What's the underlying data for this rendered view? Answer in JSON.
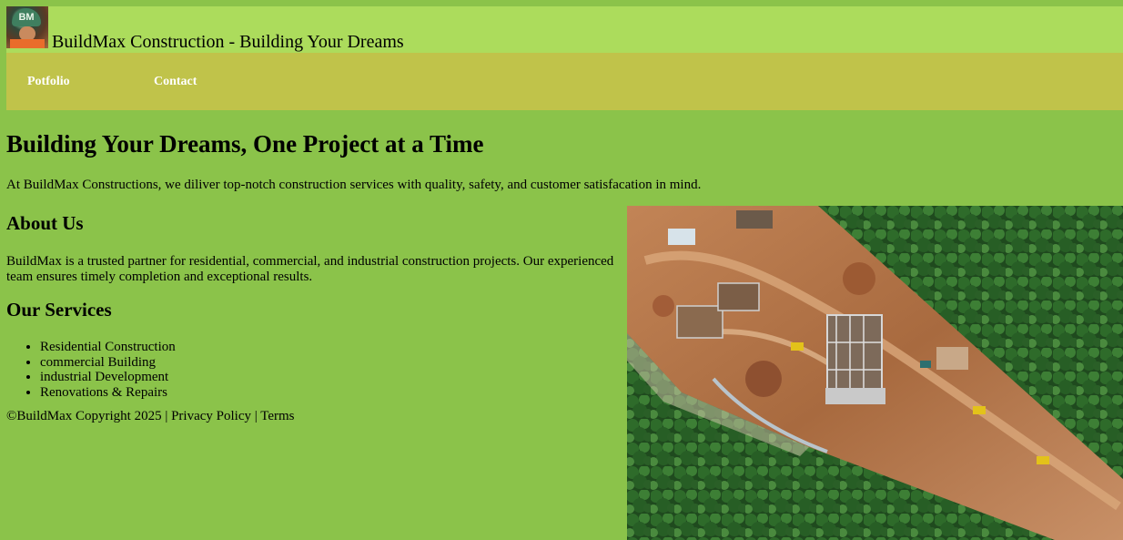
{
  "header": {
    "logo_text": "BM",
    "title": "BuildMax Construction - Building Your Dreams"
  },
  "nav": {
    "items": [
      {
        "label": "Potfolio"
      },
      {
        "label": "Contact"
      }
    ]
  },
  "hero": {
    "title": "Building Your Dreams, One Project at a Time",
    "text": "At BuildMax Constructions, we diliver top-notch construction services with quality, safety, and customer satisfacation in mind."
  },
  "about": {
    "title": "About Us",
    "text": "BuildMax is a trusted partner for residential, commercial, and industrial construction projects. Our experienced team ensures timely completion and exceptional results."
  },
  "services": {
    "title": "Our Services",
    "items": [
      "Residential Construction",
      "commercial Building",
      "industrial Development",
      "Renovations & Repairs"
    ]
  },
  "footer": {
    "copyright": "©BuildMax Copyright 2025",
    "separator": " | ",
    "privacy": "Privacy Policy",
    "terms": "Terms"
  },
  "colors": {
    "page_background": "#8bc34a",
    "header_background": "#acdc5c",
    "nav_background": "#c0c34a",
    "nav_text": "#ffffff"
  }
}
